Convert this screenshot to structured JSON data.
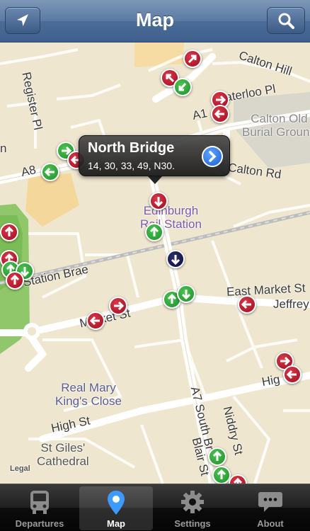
{
  "nav": {
    "title": "Map",
    "left_icon": "location-arrow-icon",
    "right_icon": "search-icon"
  },
  "map": {
    "streets": {
      "register_pl": "Register Pl",
      "calton_hill": "Calton Hill",
      "waterloo_pl": "aterloo Pl",
      "a1": "A1",
      "calton_rd": "Calton Rd",
      "a8": "A8",
      "station_brae": "Station Brae",
      "east_market_st": "East Market St",
      "jeffrey": "Jeffrey",
      "market_st": "Market St",
      "high_st_left": "High St",
      "high_st_right": "Hig",
      "a7_south_br": "A7 South Br",
      "niddry_st": "Niddry St",
      "blair_st": "Blair St",
      "n_fragment": "n"
    },
    "pois": {
      "calton_old": "Calton Old",
      "burial_ground": "Burial Ground",
      "edinburgh": "Edinburgh",
      "rail_station": "Rail Station",
      "real_mary": "Real Mary",
      "kings_close": "King's Close",
      "st_giles": "St Giles'",
      "cathedral": "Cathedral"
    },
    "legal": "Legal"
  },
  "callout": {
    "title": "North Bridge",
    "subtitle": "14, 30, 33, 49, N30.",
    "button_icon": "chevron-right-icon"
  },
  "colors": {
    "stop_red": "#b5172a",
    "stop_green": "#2fa83a",
    "stop_navy": "#14184d",
    "nav_blue": "#4d6d98"
  },
  "tabs": [
    {
      "label": "Departures",
      "icon": "bus-icon"
    },
    {
      "label": "Map",
      "icon": "map-pin-icon"
    },
    {
      "label": "Settings",
      "icon": "gear-icon"
    },
    {
      "label": "About",
      "icon": "speech-bubble-icon"
    }
  ]
}
